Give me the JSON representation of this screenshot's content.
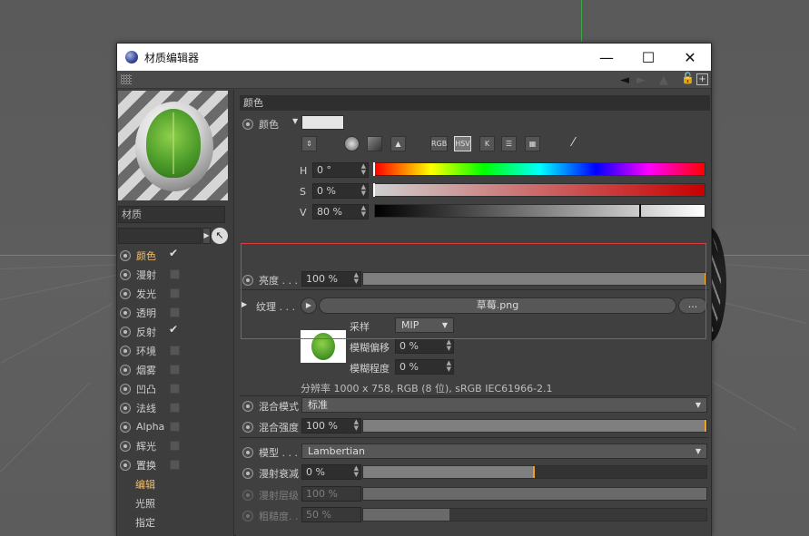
{
  "window": {
    "title": "材质编辑器",
    "minimize": "—",
    "maximize": "☐",
    "close": "✕"
  },
  "toolbar": {
    "nav_back": "◄",
    "nav_fwd": "►",
    "nav_up": "▲",
    "lock_icon": "lock-icon",
    "new_icon": "+"
  },
  "left": {
    "material_name": "材质",
    "search_value": "",
    "channels": [
      {
        "label": "颜色",
        "checked": true,
        "active": true
      },
      {
        "label": "漫射",
        "checked": false
      },
      {
        "label": "发光",
        "checked": false
      },
      {
        "label": "透明",
        "checked": false
      },
      {
        "label": "反射",
        "checked": true
      },
      {
        "label": "环境",
        "checked": false
      },
      {
        "label": "烟雾",
        "checked": false
      },
      {
        "label": "凹凸",
        "checked": false
      },
      {
        "label": "法线",
        "checked": false
      },
      {
        "label": "Alpha",
        "checked": false
      },
      {
        "label": "辉光",
        "checked": false
      },
      {
        "label": "置换",
        "checked": false
      }
    ],
    "tabs": [
      {
        "label": "编辑",
        "active": true
      },
      {
        "label": "光照",
        "active": false
      },
      {
        "label": "指定",
        "active": false
      }
    ]
  },
  "color": {
    "section_title": "颜色",
    "color_label": "颜色",
    "swatch_color": "#e6e6e6",
    "modes": [
      "RGB",
      "HSV",
      "K"
    ],
    "h_label": "H",
    "h_value": "0 °",
    "s_label": "S",
    "s_value": "0 %",
    "v_label": "V",
    "v_value": "80 %",
    "v_level": 0.8,
    "brightness_label": "亮度 . . .",
    "brightness_value": "100 %",
    "brightness_level": 1.0
  },
  "texture": {
    "label": "纹理 . . .",
    "file": "草莓.png",
    "more_button": "...",
    "sampling_label": "采样",
    "sampling_value": "MIP",
    "blur_offset_label": "模糊偏移",
    "blur_offset_value": "0 %",
    "blur_degree_label": "模糊程度",
    "blur_degree_value": "0 %",
    "resolution": "分辨率 1000 x 758, RGB (8 位), sRGB IEC61966-2.1"
  },
  "blend": {
    "mode_label": "混合模式",
    "mode_value": "标准",
    "strength_label": "混合强度",
    "strength_value": "100 %",
    "strength_level": 1.0
  },
  "model": {
    "model_label": "模型 . . .",
    "model_value": "Lambertian",
    "diffuse_falloff_label": "漫射衰减",
    "diffuse_falloff_value": "0 %",
    "diffuse_falloff_level": 0.5,
    "diffuse_level_label": "漫射层级",
    "diffuse_level_value": "100 %",
    "diffuse_level_level": 1.0,
    "roughness_label": "粗糙度. .",
    "roughness_value": "50 %",
    "roughness_level": 0.25
  }
}
